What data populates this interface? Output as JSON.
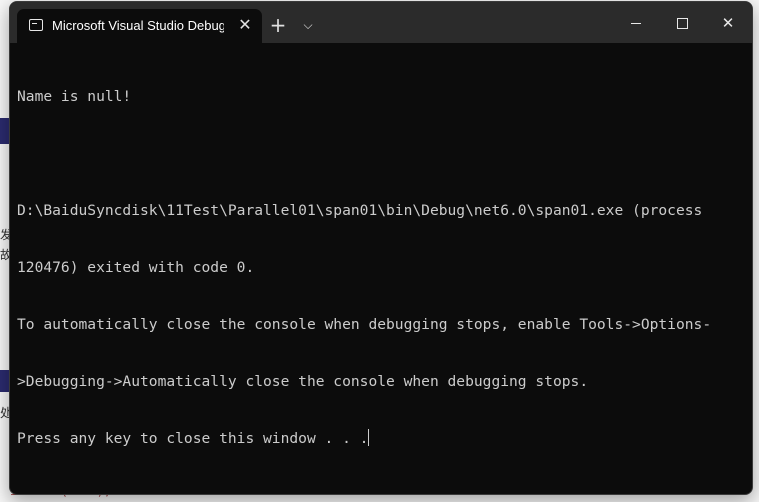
{
  "window": {
    "tab_title": "Microsoft Visual Studio Debug Console",
    "tab_icon": "terminal-icon",
    "new_tab_symbol": "+",
    "dropdown_symbol": "⌵",
    "close_symbol": "✕",
    "minimize_icon": "minimize-icon",
    "maximize_icon": "maximize-icon"
  },
  "console": {
    "lines": [
      "Name is null!",
      "",
      "D:\\BaiduSyncdisk\\11Test\\Parallel01\\span01\\bin\\Debug\\net6.0\\span01.exe (process",
      "120476) exited with code 0.",
      "To automatically close the console when debugging stops, enable Tools->Options-",
      ">Debugging->Automatically close the console when debugging stops.",
      "Press any key to close this window . . ."
    ]
  },
  "background": {
    "frag1": "发",
    "frag2": "故",
    "frag3": "处",
    "code": "intName(null);"
  },
  "colors": {
    "terminal_bg": "#0c0c0c",
    "titlebar_bg": "#2b2b2b",
    "text": "#cccccc"
  }
}
